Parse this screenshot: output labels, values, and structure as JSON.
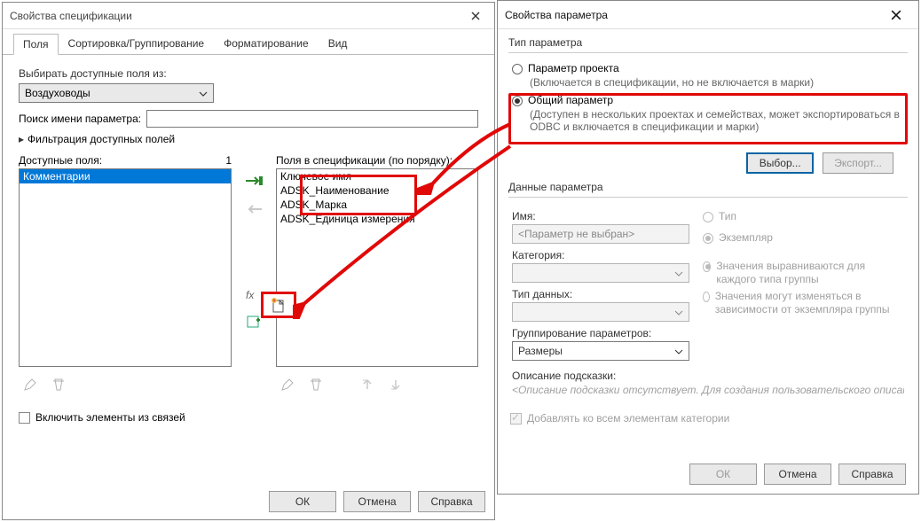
{
  "left": {
    "title": "Свойства спецификации",
    "tabs": [
      "Поля",
      "Сортировка/Группирование",
      "Форматирование",
      "Вид"
    ],
    "pick_from": "Выбирать доступные поля из:",
    "pick_value": "Воздуховоды",
    "search_lbl": "Поиск имени параметра:",
    "filter_lbl": "Фильтрация доступных полей",
    "avail_lbl": "Доступные поля:",
    "avail_count": "1",
    "avail_items": [
      "Комментарии"
    ],
    "spec_lbl": "Поля в спецификации (по порядку):",
    "spec_items": [
      "Ключевое имя",
      "ADSK_Наименование",
      "ADSK_Марка",
      "ADSK_Единица измерения"
    ],
    "include_links": "Включить элементы из связей",
    "ok": "ОК",
    "cancel": "Отмена",
    "help": "Справка"
  },
  "right": {
    "title": "Свойства параметра",
    "grp_type": "Тип параметра",
    "r1": "Параметр проекта",
    "r1_hint": "(Включается в спецификации, но не включается в марки)",
    "r2": "Общий параметр",
    "r2_hint": "(Доступен в нескольких проектах и семействах, может экспортироваться в ODBC и включается в спецификации и марки)",
    "select_btn": "Выбор...",
    "export_btn": "Экспорт...",
    "grp_data": "Данные параметра",
    "name_lbl": "Имя:",
    "name_val": "<Параметр не выбран>",
    "type_radio": "Тип",
    "inst_radio": "Экземпляр",
    "cat_lbl": "Категория:",
    "dtype_lbl": "Тип данных:",
    "align1": "Значения выравниваются для каждого типа группы",
    "align2": "Значения могут изменяться в зависимости от экземпляра группы",
    "group_lbl": "Группирование параметров:",
    "group_val": "Размеры",
    "tip_lbl": "Описание подсказки:",
    "tip_val": "<Описание подсказки отсутствует. Для создания пользовательского описания отр...",
    "add_all": "Добавлять ко всем элементам категории",
    "ok": "ОК",
    "cancel": "Отмена",
    "help": "Справка"
  }
}
